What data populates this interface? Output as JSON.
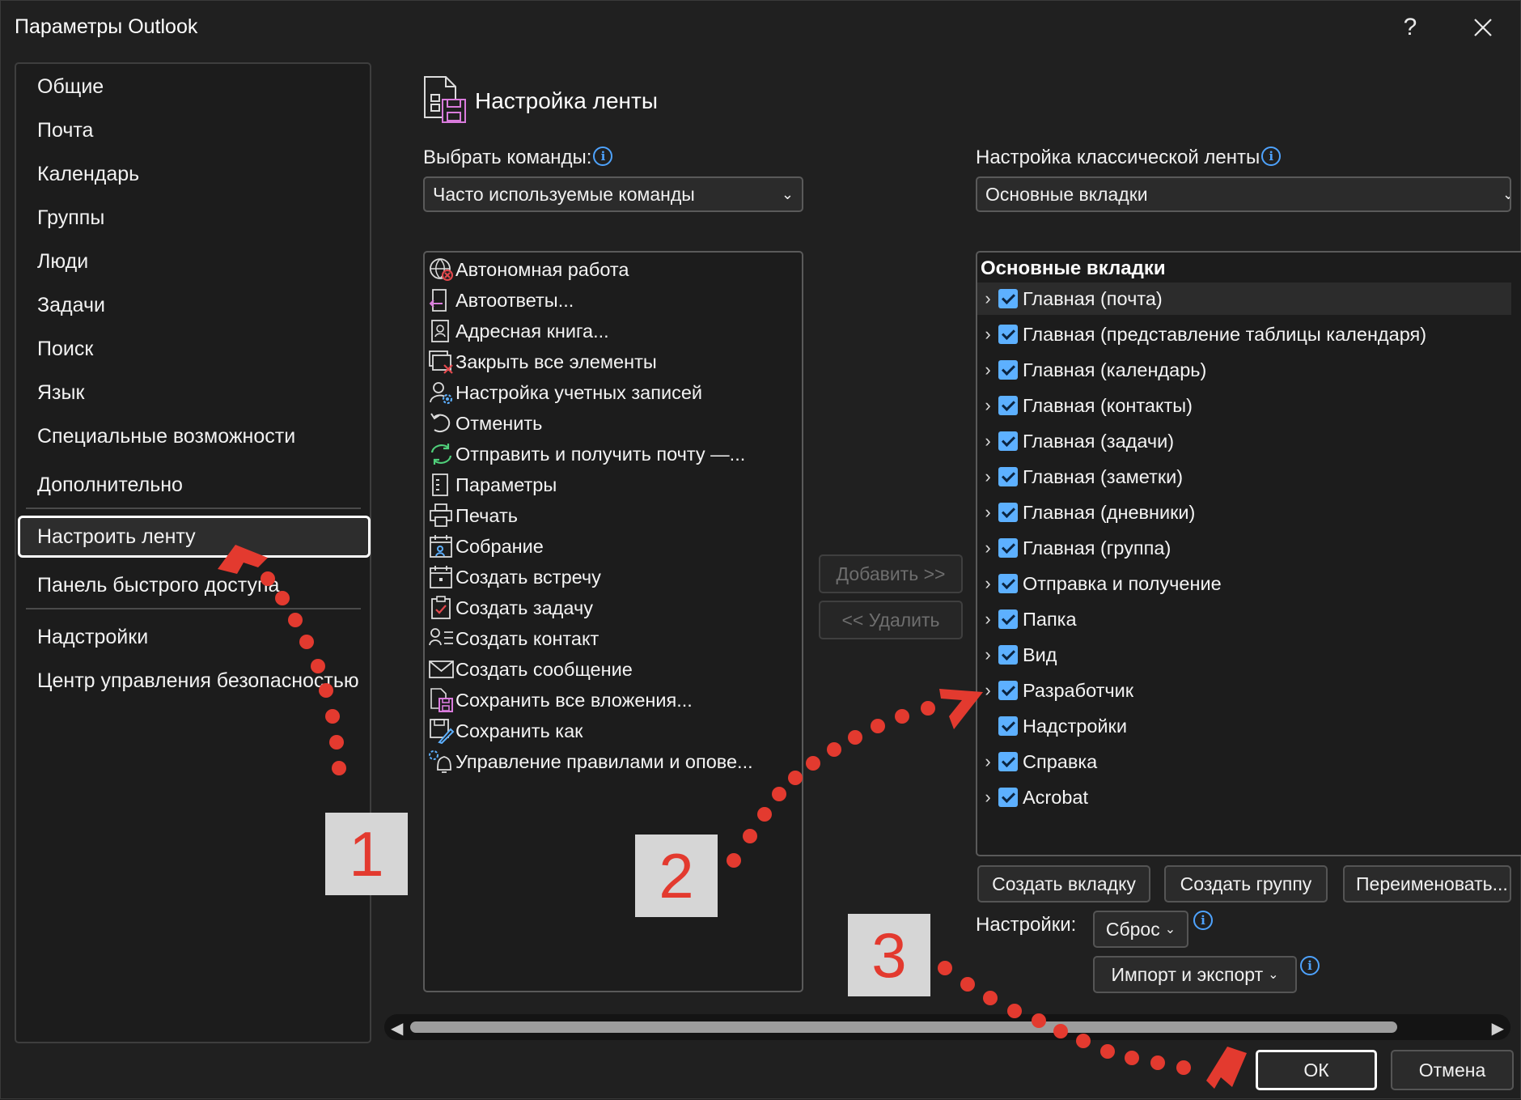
{
  "window": {
    "title": "Параметры Outlook",
    "help_label": "?",
    "close_label": "✕"
  },
  "nav": {
    "items": [
      {
        "label": "Общие"
      },
      {
        "label": "Почта"
      },
      {
        "label": "Календарь"
      },
      {
        "label": "Группы"
      },
      {
        "label": "Люди"
      },
      {
        "label": "Задачи"
      },
      {
        "label": "Поиск"
      },
      {
        "label": "Язык"
      },
      {
        "label": "Специальные возможности"
      },
      {
        "label": "Дополнительно"
      },
      {
        "label": "Настроить ленту",
        "selected": true
      },
      {
        "label": "Панель быстрого доступа"
      },
      {
        "label": "Надстройки"
      },
      {
        "label": "Центр управления безопасностью"
      }
    ]
  },
  "section": {
    "title": "Настройка ленты",
    "choose_label": "Выбрать команды:",
    "choose_value": "Часто используемые команды",
    "customize_label": "Настройка классической ленты",
    "customize_value": "Основные вкладки"
  },
  "commands": [
    {
      "label": "Автономная работа",
      "icon": "globe-offline-icon"
    },
    {
      "label": "Автоответы...",
      "icon": "auto-reply-icon"
    },
    {
      "label": "Адресная книга...",
      "icon": "address-book-icon"
    },
    {
      "label": "Закрыть все элементы",
      "icon": "close-all-icon"
    },
    {
      "label": "Настройка учетных записей",
      "icon": "account-settings-icon"
    },
    {
      "label": "Отменить",
      "icon": "undo-icon"
    },
    {
      "label": "Отправить и получить почту —...",
      "icon": "send-receive-icon"
    },
    {
      "label": "Параметры",
      "icon": "options-icon"
    },
    {
      "label": "Печать",
      "icon": "print-icon"
    },
    {
      "label": "Собрание",
      "icon": "meeting-icon"
    },
    {
      "label": "Создать встречу",
      "icon": "new-appointment-icon"
    },
    {
      "label": "Создать задачу",
      "icon": "new-task-icon"
    },
    {
      "label": "Создать контакт",
      "icon": "new-contact-icon"
    },
    {
      "label": "Создать сообщение",
      "icon": "new-message-icon"
    },
    {
      "label": "Сохранить все вложения...",
      "icon": "save-attachments-icon"
    },
    {
      "label": "Сохранить как",
      "icon": "save-as-icon"
    },
    {
      "label": "Управление правилами и опове...",
      "icon": "rules-alerts-icon"
    }
  ],
  "transfer": {
    "add_label": "Добавить >>",
    "remove_label": "<< Удалить"
  },
  "tabs_tree": {
    "header": "Основные вкладки",
    "items": [
      {
        "label": "Главная (почта)",
        "expandable": true,
        "checked": true
      },
      {
        "label": "Главная (представление таблицы календаря)",
        "expandable": true,
        "checked": true
      },
      {
        "label": "Главная (календарь)",
        "expandable": true,
        "checked": true
      },
      {
        "label": "Главная (контакты)",
        "expandable": true,
        "checked": true
      },
      {
        "label": "Главная (задачи)",
        "expandable": true,
        "checked": true
      },
      {
        "label": "Главная (заметки)",
        "expandable": true,
        "checked": true
      },
      {
        "label": "Главная (дневники)",
        "expandable": true,
        "checked": true
      },
      {
        "label": "Главная (группа)",
        "expandable": true,
        "checked": true
      },
      {
        "label": "Отправка и получение",
        "expandable": true,
        "checked": true
      },
      {
        "label": "Папка",
        "expandable": true,
        "checked": true
      },
      {
        "label": "Вид",
        "expandable": true,
        "checked": true
      },
      {
        "label": "Разработчик",
        "expandable": true,
        "checked": true
      },
      {
        "label": "Надстройки",
        "expandable": false,
        "checked": true
      },
      {
        "label": "Справка",
        "expandable": true,
        "checked": true
      },
      {
        "label": "Acrobat",
        "expandable": true,
        "checked": true
      }
    ]
  },
  "tree_buttons": {
    "new_tab": "Создать вкладку",
    "new_group": "Создать группу",
    "rename": "Переименовать..."
  },
  "settings": {
    "label": "Настройки:",
    "reset": "Сброс",
    "import_export": "Импорт и экспорт"
  },
  "footer": {
    "ok": "ОК",
    "cancel": "Отмена"
  },
  "annotations": {
    "badge1": "1",
    "badge2": "2",
    "badge3": "3",
    "color": "#e33a2f"
  }
}
